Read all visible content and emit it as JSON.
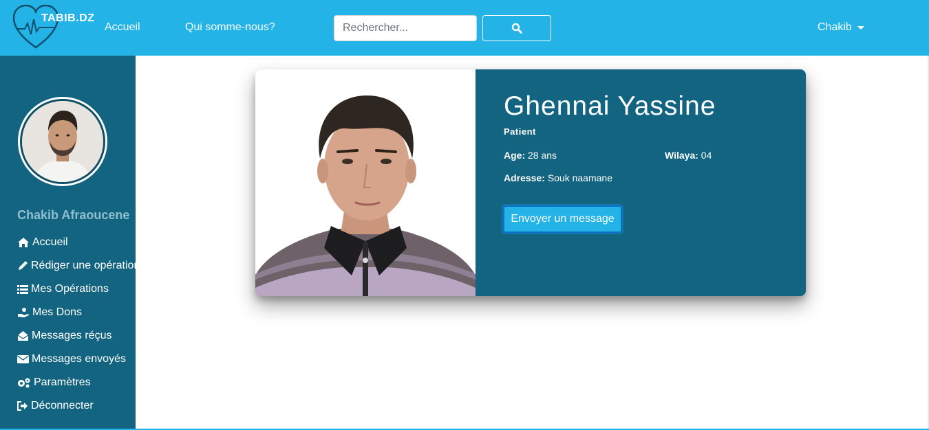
{
  "navbar": {
    "brand": "TABIB.DZ",
    "links": [
      "Accueil",
      "Qui somme-nous?"
    ],
    "search_placeholder": "Rechercher...",
    "user": "Chakib",
    "colors": {
      "background": "#23b3e6"
    }
  },
  "sidebar": {
    "user_name": "Chakib Afraoucene",
    "items": [
      {
        "label": "Accueil",
        "icon": "home-icon"
      },
      {
        "label": "Rédiger une opération",
        "icon": "pen-icon"
      },
      {
        "label": "Mes Opérations",
        "icon": "list-icon"
      },
      {
        "label": "Mes Dons",
        "icon": "donate-icon"
      },
      {
        "label": "Messages réçus",
        "icon": "envelope-open-icon"
      },
      {
        "label": "Messages envoyés",
        "icon": "envelope-icon"
      },
      {
        "label": "Paramètres",
        "icon": "gears-icon"
      },
      {
        "label": "Déconnecter",
        "icon": "sign-out-icon"
      }
    ],
    "colors": {
      "background": "#136480",
      "name": "#8ebfcf"
    }
  },
  "profile": {
    "name": "Ghennai Yassine",
    "role": "Patient",
    "age_label": "Age:",
    "age_value": "28 ans",
    "wilaya_label": "Wilaya:",
    "wilaya_value": "04",
    "adresse_label": "Adresse:",
    "adresse_value": "Souk naamane",
    "message_button": "Envoyer un message",
    "colors": {
      "card": "#136480",
      "button": "#23b3e6",
      "button_border": "#0b73c2"
    }
  }
}
